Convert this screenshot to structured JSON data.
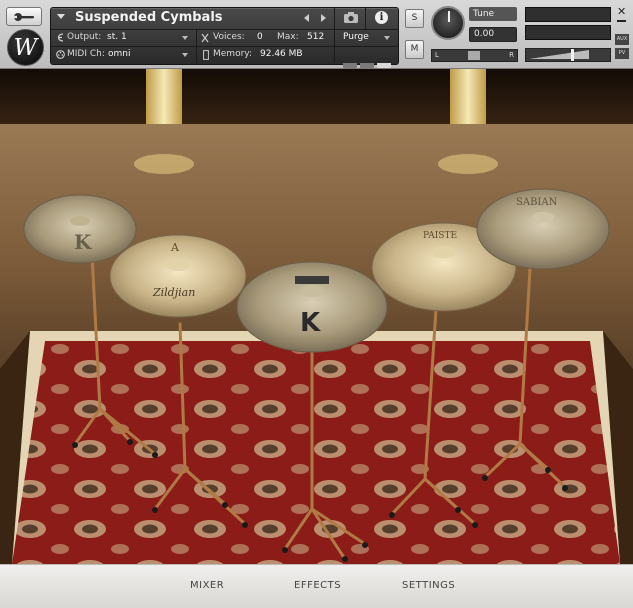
{
  "header": {
    "instrument_name": "Suspended Cymbals",
    "output_label": "Output:",
    "output_value": "st. 1",
    "midi_label": "MIDI Ch:",
    "midi_value": "omni",
    "voices_label": "Voices:",
    "voices_value": "0",
    "max_label": "Max:",
    "max_value": "512",
    "memory_label": "Memory:",
    "memory_value": "92.46 MB",
    "purge_label": "Purge",
    "solo_label": "S",
    "mute_label": "M",
    "tune_label": "Tune",
    "tune_value": "0.00",
    "pan_left": "L",
    "pan_right": "R",
    "aux_label": "AUX",
    "pv_label": "PV",
    "icons": [
      "wrench-icon",
      "logo-icon",
      "menu-arrow-icon",
      "prev-arrow-icon",
      "next-arrow-icon",
      "camera-icon",
      "info-icon",
      "output-icon",
      "midi-icon",
      "voices-icon",
      "memory-icon",
      "close-icon",
      "minimize-icon"
    ]
  },
  "logo_text": "W",
  "cymbal_labels": [
    "K",
    "A",
    "Zildjian",
    "K",
    "PAISTE",
    "SABIAN"
  ],
  "tabs": [
    {
      "label": "MIXER"
    },
    {
      "label": "EFFECTS"
    },
    {
      "label": "SETTINGS"
    }
  ]
}
